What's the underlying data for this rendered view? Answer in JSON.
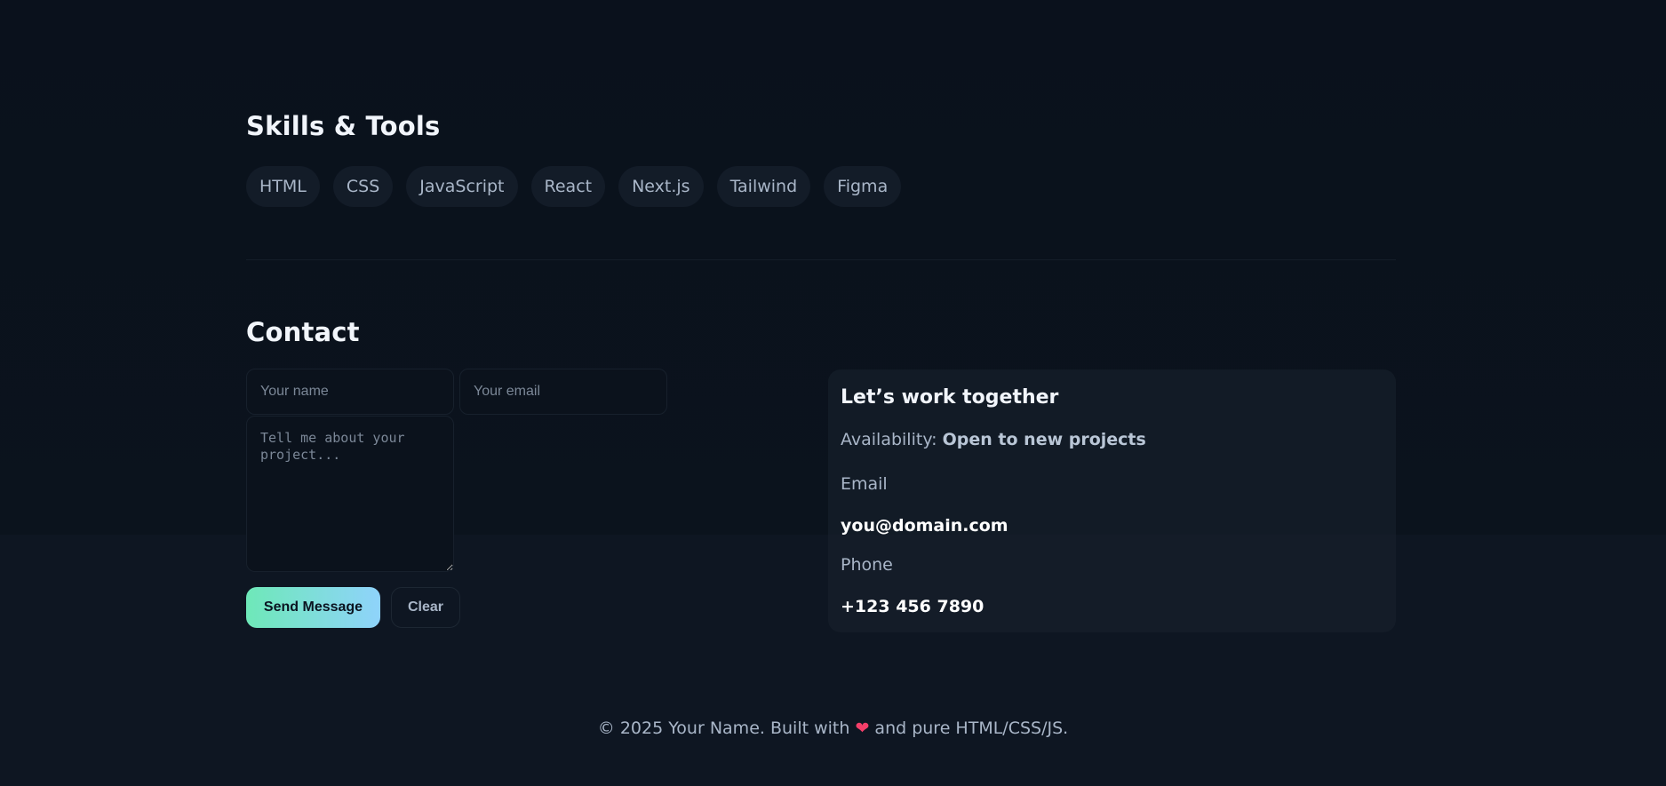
{
  "skills": {
    "title": "Skills & Tools",
    "items": [
      "HTML",
      "CSS",
      "JavaScript",
      "React",
      "Next.js",
      "Tailwind",
      "Figma"
    ]
  },
  "contact": {
    "title": "Contact",
    "form": {
      "name_placeholder": "Your name",
      "email_placeholder": "Your email",
      "message_placeholder": "Tell me about your project...",
      "send_label": "Send Message",
      "clear_label": "Clear"
    },
    "card": {
      "title": "Let’s work together",
      "availability_label": "Availability:",
      "availability_value": "Open to new projects",
      "email_label": "Email",
      "email_value": "you@domain.com",
      "phone_label": "Phone",
      "phone_value": "+123 456 7890"
    }
  },
  "footer": {
    "text_before": "© 2025 Your Name. Built with",
    "heart": "❤",
    "text_after": "and pure HTML/CSS/JS."
  },
  "colors": {
    "accent_gradient_start": "#6ee8b8",
    "accent_gradient_end": "#8fd3fb",
    "heart": "#f43f6a"
  }
}
